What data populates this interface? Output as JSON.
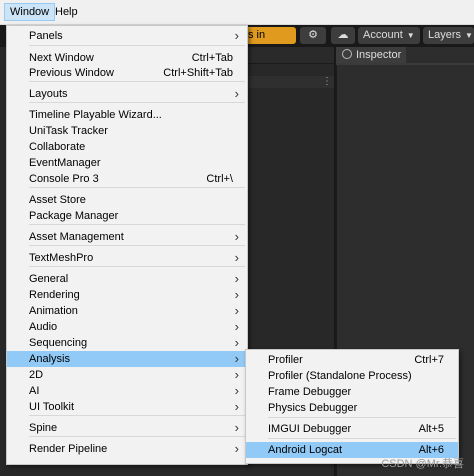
{
  "menubar": {
    "window": "Window",
    "help": "Help"
  },
  "toolbar": {
    "assets_in_use": "s in Use",
    "account": "Account",
    "layers": "Layers",
    "inspector_tab": "Inspector",
    "in_use_color": "#e09b1f"
  },
  "window_menu": [
    {
      "label": "Panels",
      "submenu": true
    },
    {
      "label": "Next Window",
      "shortcut": "Ctrl+Tab"
    },
    {
      "label": "Previous Window",
      "shortcut": "Ctrl+Shift+Tab"
    },
    {
      "label": "Layouts",
      "submenu": true
    },
    {
      "label": "Timeline Playable Wizard..."
    },
    {
      "label": "UniTask Tracker"
    },
    {
      "label": "Collaborate"
    },
    {
      "label": "EventManager"
    },
    {
      "label": "Console Pro 3",
      "shortcut": "Ctrl+\\"
    },
    {
      "label": "Asset Store"
    },
    {
      "label": "Package Manager"
    },
    {
      "label": "Asset Management",
      "submenu": true
    },
    {
      "label": "TextMeshPro",
      "submenu": true
    },
    {
      "label": "General",
      "submenu": true
    },
    {
      "label": "Rendering",
      "submenu": true
    },
    {
      "label": "Animation",
      "submenu": true
    },
    {
      "label": "Audio",
      "submenu": true
    },
    {
      "label": "Sequencing",
      "submenu": true
    },
    {
      "label": "Analysis",
      "submenu": true,
      "highlighted": true
    },
    {
      "label": "2D",
      "submenu": true
    },
    {
      "label": "AI",
      "submenu": true
    },
    {
      "label": "UI Toolkit",
      "submenu": true
    },
    {
      "label": "Spine",
      "submenu": true
    },
    {
      "label": "Render Pipeline",
      "submenu": true
    }
  ],
  "analysis_submenu": [
    {
      "label": "Profiler",
      "shortcut": "Ctrl+7"
    },
    {
      "label": "Profiler (Standalone Process)"
    },
    {
      "label": "Frame Debugger"
    },
    {
      "label": "Physics Debugger"
    },
    {
      "label": "IMGUI Debugger",
      "shortcut": "Alt+5"
    },
    {
      "label": "Android Logcat",
      "shortcut": "Alt+6",
      "highlighted": true
    }
  ],
  "highlight_color": "#91c9f7",
  "watermark": "CSDN @Mr.恭喜"
}
